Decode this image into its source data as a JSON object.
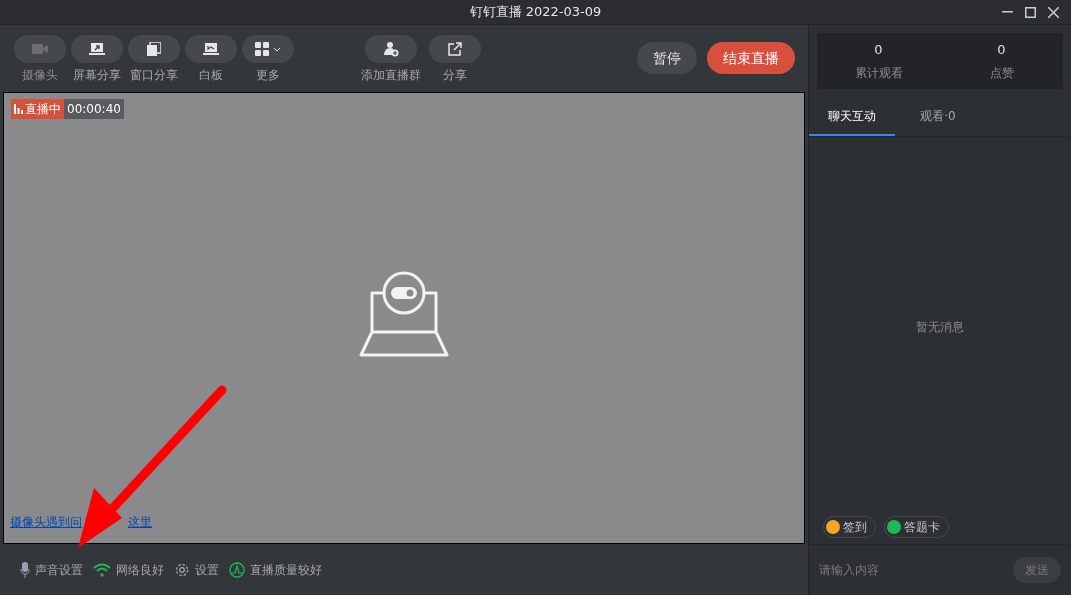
{
  "window": {
    "title": "钉钉直播 2022-03-09"
  },
  "toolbar": {
    "tools": [
      {
        "kind": "camera",
        "label": "摄像头",
        "disabled": true
      },
      {
        "kind": "screen",
        "label": "屏幕分享",
        "disabled": false
      },
      {
        "kind": "window",
        "label": "窗口分享",
        "disabled": false
      },
      {
        "kind": "whiteboard",
        "label": "白板",
        "disabled": false
      },
      {
        "kind": "more",
        "label": "更多",
        "disabled": false
      }
    ],
    "center_tools": [
      {
        "kind": "group",
        "label": "添加直播群",
        "disabled": false
      },
      {
        "kind": "share",
        "label": "分享",
        "disabled": false
      }
    ],
    "pause_button": "暂停",
    "end_button": "结束直播"
  },
  "video": {
    "live_badge": "直播中",
    "elapsed": "00:00:40",
    "help_link_parts": [
      "摄像头遇到问",
      "这里"
    ]
  },
  "status_bar": [
    {
      "kind": "mic",
      "label": "声音设置"
    },
    {
      "kind": "wifi",
      "label": "网络良好"
    },
    {
      "kind": "gear",
      "label": "设置"
    },
    {
      "kind": "quality",
      "label": "直播质量较好"
    }
  ],
  "stats": [
    {
      "value": "0",
      "label": "累计观看"
    },
    {
      "value": "0",
      "label": "点赞"
    }
  ],
  "tabs": [
    {
      "label": "聊天互动",
      "selected": true
    },
    {
      "label": "观看·0",
      "selected": false
    }
  ],
  "empty_message": "暂无消息",
  "chips": [
    {
      "label": "签到",
      "color": "#f5a623"
    },
    {
      "label": "答题卡",
      "color": "#1fb855"
    }
  ],
  "chat_input": {
    "placeholder": "请输入内容"
  },
  "send_button": "发送"
}
